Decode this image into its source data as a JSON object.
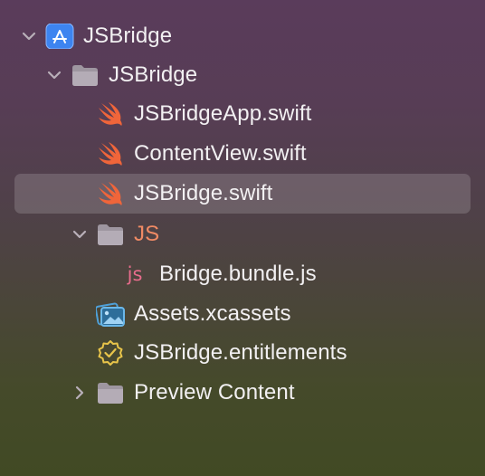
{
  "navigator": {
    "items": [
      {
        "label": "JSBridge",
        "icon": "xcode-project-icon",
        "disclosure": "expanded"
      },
      {
        "label": "JSBridge",
        "icon": "folder-icon",
        "disclosure": "expanded"
      },
      {
        "label": "JSBridgeApp.swift",
        "icon": "swift-icon"
      },
      {
        "label": "ContentView.swift",
        "icon": "swift-icon"
      },
      {
        "label": "JSBridge.swift",
        "icon": "swift-icon",
        "selected": true
      },
      {
        "label": "JS",
        "icon": "folder-icon",
        "disclosure": "expanded"
      },
      {
        "label": "Bridge.bundle.js",
        "icon": "js-file-icon",
        "icon_text": "js"
      },
      {
        "label": "Assets.xcassets",
        "icon": "asset-catalog-icon"
      },
      {
        "label": "JSBridge.entitlements",
        "icon": "entitlements-icon"
      },
      {
        "label": "Preview Content",
        "icon": "folder-icon",
        "disclosure": "collapsed"
      }
    ]
  },
  "colors": {
    "text": "#f2f0f2",
    "folder_name_highlight": "#f08a64",
    "swift_orange": "#f0653a",
    "js_pink": "#e86c8c",
    "project_blue": "#3d84f0",
    "asset_blue": "#4ea0d8",
    "entitlement_yellow": "#e8c44a",
    "selection": "rgba(255,255,255,0.16)"
  }
}
